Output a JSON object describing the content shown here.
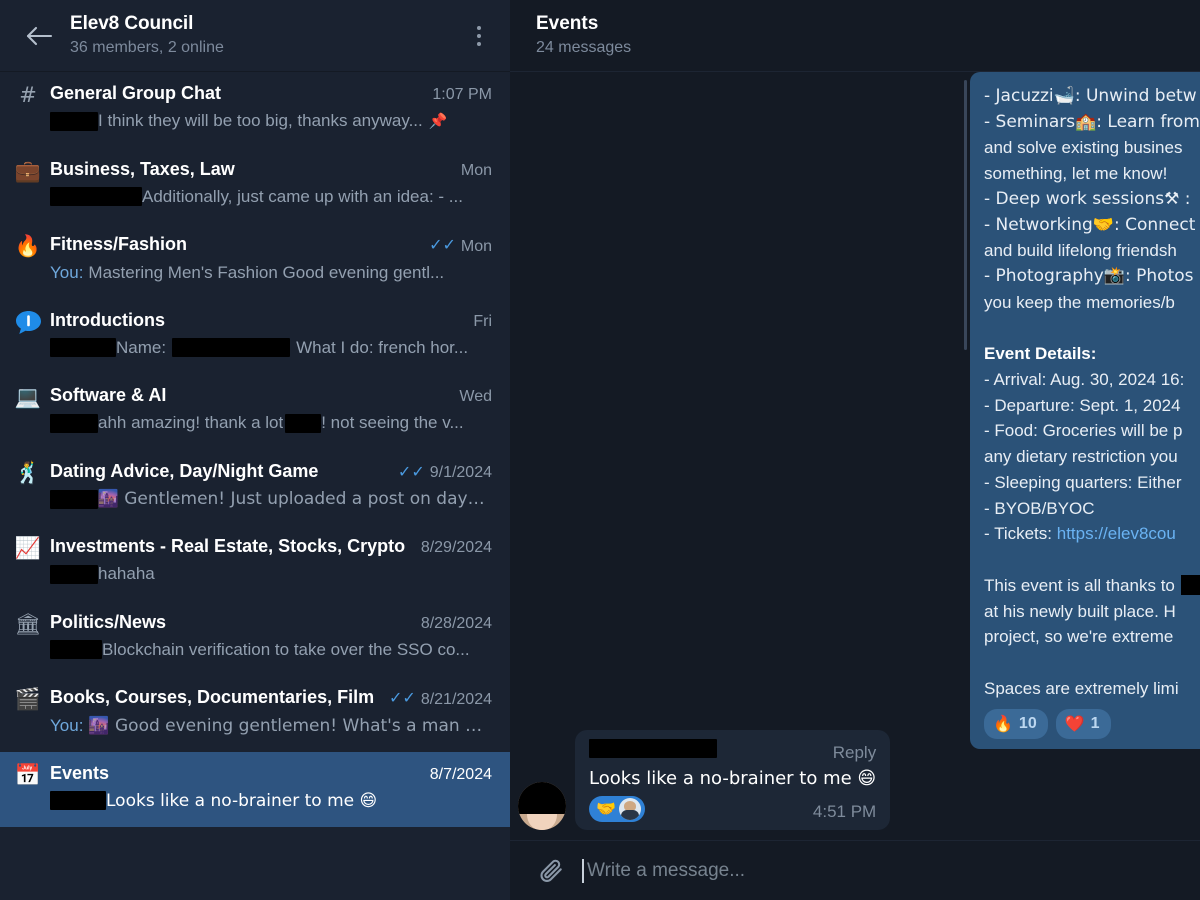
{
  "sidebar": {
    "back_icon": "arrow-left-icon",
    "title": "Elev8 Council",
    "subtitle": "36 members, 2 online",
    "menu_icon": "more-vertical-icon",
    "chats": [
      {
        "icon": "#",
        "icon_name": "hash-icon",
        "title": "General Group Chat",
        "date": "1:07 PM",
        "ticks": "",
        "prefix": "",
        "redact_width": 48,
        "message": "I think they will be too big, thanks anyway...",
        "pin": "📌",
        "selected": false
      },
      {
        "icon": "💼",
        "icon_name": "briefcase-icon",
        "title": "Business, Taxes, Law",
        "date": "Mon",
        "ticks": "",
        "prefix": "",
        "redact_width": 92,
        "message": "Additionally, just came up with an idea: - ...",
        "pin": "",
        "selected": false
      },
      {
        "icon": "🔥",
        "icon_name": "fire-icon",
        "title": "Fitness/Fashion",
        "date": "Mon",
        "ticks": "✓✓",
        "prefix": "You:",
        "redact_width": 0,
        "message": "Mastering Men's Fashion  Good evening gentl...",
        "pin": "",
        "selected": false
      },
      {
        "icon": "💬",
        "icon_name": "introductions-bubble-icon",
        "title": "Introductions",
        "date": "Fri",
        "ticks": "",
        "prefix": "",
        "redact_width": 66,
        "message": "Name:",
        "message2": "What I do: french hor...",
        "redact_width2": 118,
        "pin": "",
        "selected": false
      },
      {
        "icon": "💻",
        "icon_name": "laptop-icon",
        "title": "Software & AI",
        "date": "Wed",
        "ticks": "",
        "prefix": "",
        "redact_width": 48,
        "message": "ahh amazing! thank a lot",
        "message2": "! not seeing the v...",
        "redact_width2": 36,
        "pin": "",
        "selected": false
      },
      {
        "icon": "🕺",
        "icon_name": "dancing-man-icon",
        "title": "Dating Advice, Day/Night Game",
        "date": "9/1/2024",
        "ticks": "✓✓",
        "prefix": "",
        "redact_width": 48,
        "message": "🌆 Gentlemen!  Just uploaded a post on dayg...",
        "pin": "",
        "selected": false
      },
      {
        "icon": "📈",
        "icon_name": "chart-increasing-icon",
        "title": "Investments - Real Estate, Stocks, Crypto",
        "date": "8/29/2024",
        "ticks": "",
        "prefix": "",
        "redact_width": 48,
        "message": "hahaha",
        "pin": "",
        "selected": false
      },
      {
        "icon": "🏛",
        "icon_name": "classical-building-icon",
        "title": "Politics/News",
        "date": "8/28/2024",
        "ticks": "",
        "prefix": "",
        "redact_width": 52,
        "message": "Blockchain verification to take over the SSO co...",
        "pin": "",
        "selected": false
      },
      {
        "icon": "🎬",
        "icon_name": "clapper-board-icon",
        "title": "Books, Courses, Documentaries, Film",
        "date": "8/21/2024",
        "ticks": "✓✓",
        "prefix": "You:",
        "redact_width": 0,
        "message": "🌆 Good evening gentlemen! What's a man w...",
        "pin": "",
        "selected": false
      },
      {
        "icon": "📅",
        "icon_name": "calendar-icon",
        "title": "Events",
        "date": "8/7/2024",
        "ticks": "",
        "prefix": "",
        "redact_width": 56,
        "message": "Looks like a no-brainer to me 😄",
        "pin": "",
        "selected": true
      }
    ]
  },
  "chat": {
    "header": {
      "title": "Events",
      "subtitle": "24 messages"
    },
    "pinned_message": {
      "lines": [
        "- Jacuzzi🛁: Unwind betw",
        "- Seminars🏫: Learn from",
        "and solve existing busines",
        "something, let me know!",
        "- Deep work sessions⚒ : ",
        "- Networking🤝: Connect",
        "and build lifelong friendsh",
        "- Photography📸: Photos",
        "you keep the memories/b"
      ],
      "details_heading": "Event Details:",
      "detail_lines": [
        "- Arrival: Aug. 30, 2024 16:",
        "- Departure: Sept. 1, 2024",
        "- Food: Groceries will be p",
        "any dietary restriction you",
        "- Sleeping quarters: Either",
        "- BYOB/BYOC"
      ],
      "ticket_label": "- Tickets: ",
      "ticket_link": "https://elev8cou",
      "closing_lines": [
        "This event is all thanks to",
        "at his newly built place. H",
        "project, so we're extreme"
      ],
      "final_line": "Spaces are extremely limi",
      "reactions": [
        {
          "emoji": "🔥",
          "count": "10",
          "name": "fire-reaction"
        },
        {
          "emoji": "❤️",
          "count": "1",
          "name": "heart-reaction"
        }
      ]
    },
    "reply_message": {
      "reply_label": "Reply",
      "text": "Looks like a no-brainer to me 😄",
      "reaction_emoji": "🤝",
      "time": "4:51 PM"
    },
    "composer": {
      "attach_icon": "paperclip-icon",
      "placeholder": "Write a message..."
    }
  },
  "colors": {
    "app_bg": "#141a24",
    "sidebar_bg": "#1a2230",
    "selected_row": "#2e5480",
    "bubble_blue": "#2b5278",
    "bubble_dark": "#1d2736",
    "accent_blue": "#6ab3f3",
    "tick_blue": "#4a9ae0",
    "muted_text": "#93a0b0"
  }
}
